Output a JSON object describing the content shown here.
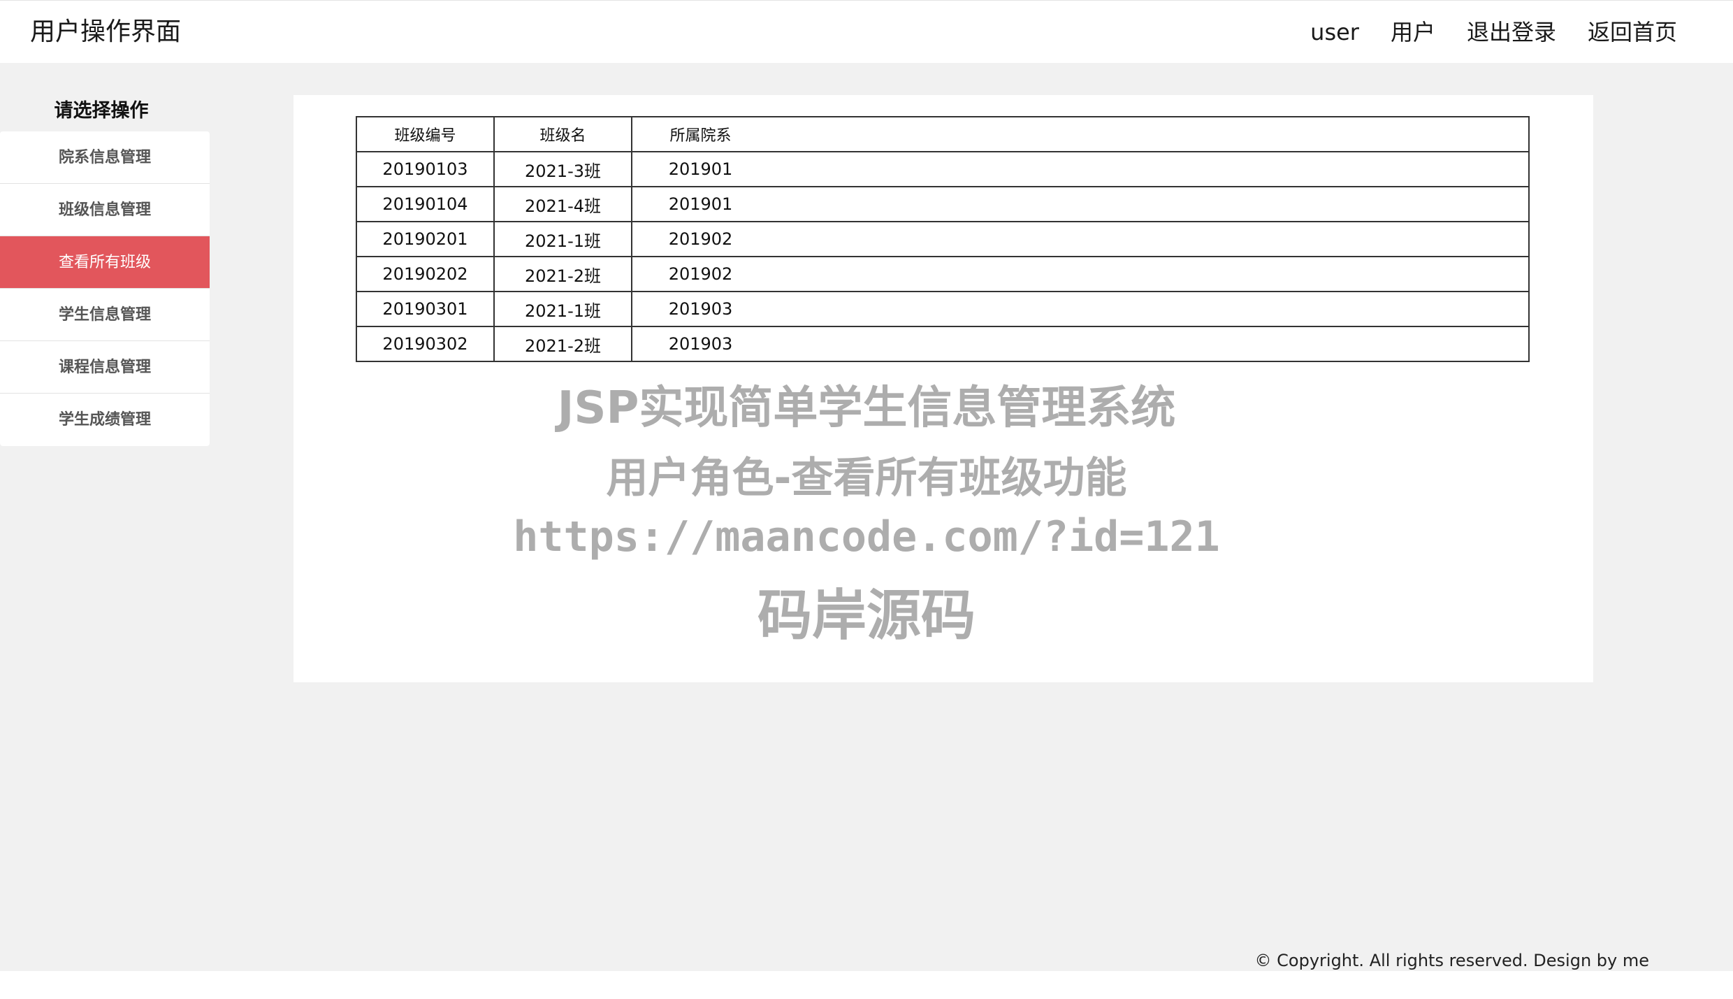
{
  "header": {
    "title": "用户操作界面",
    "nav": [
      "user",
      "用户",
      "退出登录",
      "返回首页"
    ]
  },
  "sidebar": {
    "heading": "请选择操作",
    "items": [
      {
        "label": "院系信息管理",
        "active": false
      },
      {
        "label": "班级信息管理",
        "active": false
      },
      {
        "label": "查看所有班级",
        "active": true
      },
      {
        "label": "学生信息管理",
        "active": false
      },
      {
        "label": "课程信息管理",
        "active": false
      },
      {
        "label": "学生成绩管理",
        "active": false
      }
    ]
  },
  "table": {
    "headers": [
      "班级编号",
      "班级名",
      "所属院系"
    ],
    "rows": [
      [
        "20190103",
        "2021-3班",
        "201901"
      ],
      [
        "20190104",
        "2021-4班",
        "201901"
      ],
      [
        "20190201",
        "2021-1班",
        "201902"
      ],
      [
        "20190202",
        "2021-2班",
        "201902"
      ],
      [
        "20190301",
        "2021-1班",
        "201903"
      ],
      [
        "20190302",
        "2021-2班",
        "201903"
      ]
    ]
  },
  "watermark": {
    "line1": "JSP实现简单学生信息管理系统",
    "line2": "用户角色-查看所有班级功能",
    "line3": "https://maancode.com/?id=121",
    "line4": "码岸源码"
  },
  "footer": {
    "copyright": "© Copyright. All rights reserved. Design by me"
  },
  "colors": {
    "active_item": "#e2565c",
    "page_background": "#f1f1f1"
  }
}
